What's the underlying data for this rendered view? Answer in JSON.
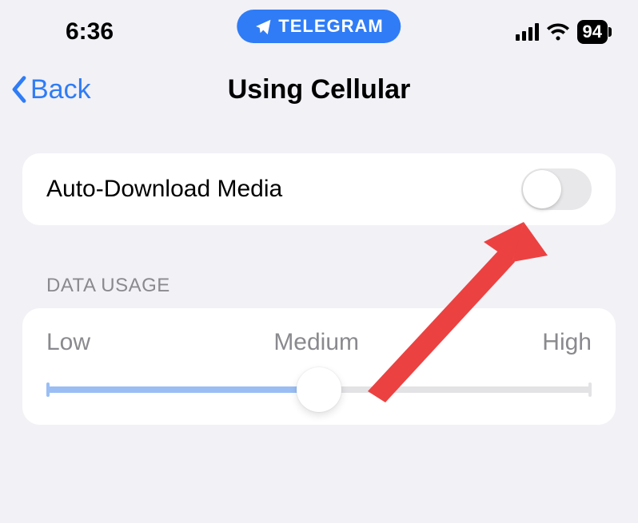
{
  "status": {
    "time": "6:36",
    "pill_label": "TELEGRAM",
    "battery": "94"
  },
  "nav": {
    "back_label": "Back",
    "title": "Using Cellular"
  },
  "media_row": {
    "label": "Auto-Download Media",
    "enabled": false
  },
  "data_usage": {
    "header": "DATA USAGE",
    "low": "Low",
    "medium": "Medium",
    "high": "High",
    "value_percent": 50
  },
  "colors": {
    "accent": "#2f7cf6",
    "annotation": "#ec4141"
  }
}
